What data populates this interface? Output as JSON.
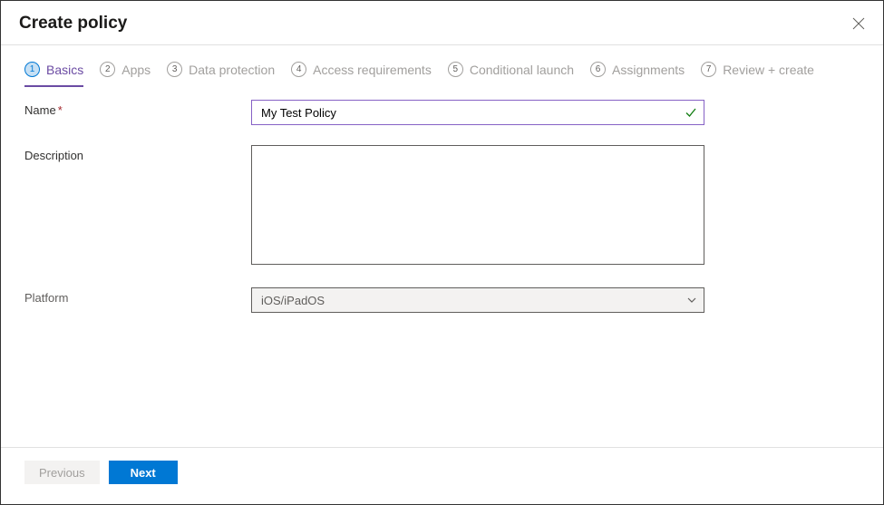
{
  "header": {
    "title": "Create policy"
  },
  "tabs": [
    {
      "num": "1",
      "label": "Basics",
      "active": true
    },
    {
      "num": "2",
      "label": "Apps",
      "active": false
    },
    {
      "num": "3",
      "label": "Data protection",
      "active": false
    },
    {
      "num": "4",
      "label": "Access requirements",
      "active": false
    },
    {
      "num": "5",
      "label": "Conditional launch",
      "active": false
    },
    {
      "num": "6",
      "label": "Assignments",
      "active": false
    },
    {
      "num": "7",
      "label": "Review + create",
      "active": false
    }
  ],
  "form": {
    "name_label": "Name",
    "name_value": "My Test Policy",
    "description_label": "Description",
    "description_value": "",
    "platform_label": "Platform",
    "platform_value": "iOS/iPadOS"
  },
  "footer": {
    "previous_label": "Previous",
    "next_label": "Next"
  }
}
